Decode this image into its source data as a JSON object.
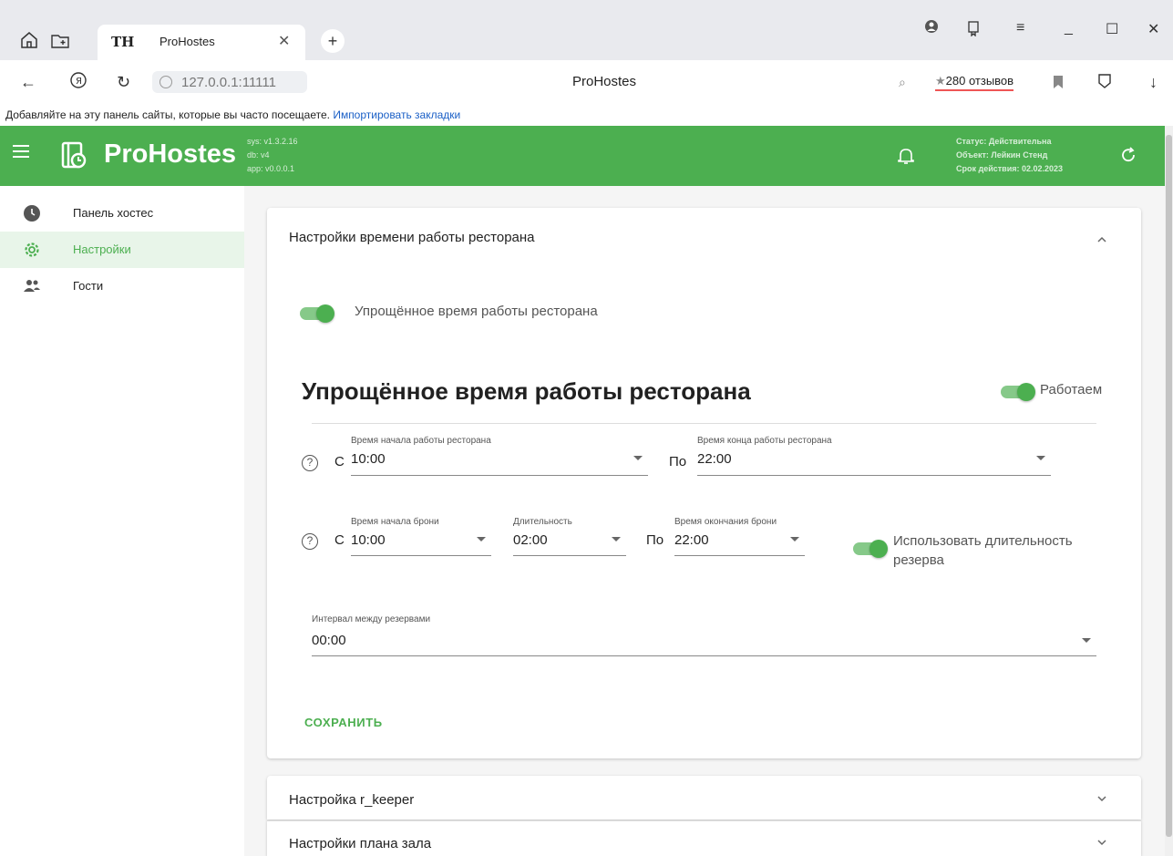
{
  "browser": {
    "tab_title": "ProHostes",
    "tab_favicon": "TН",
    "url": "127.0.0.1:11111",
    "page_title": "ProHostes",
    "reviews": "280 отзывов",
    "bookmarks_text": "Добавляйте на эту панель сайты, которые вы часто посещаете.",
    "bookmarks_link": "Импортировать закладки"
  },
  "header": {
    "brand": "ProHostes",
    "version_sys": "sys: v1.3.2.16",
    "version_db": "db: v4",
    "version_app": "app: v0.0.0.1",
    "status": "Статус: Действительна",
    "object": "Объект: Лейкин Стенд",
    "expiry": "Срок действия: 02.02.2023"
  },
  "sidebar": {
    "items": [
      {
        "label": "Панель хостес",
        "icon": "clock-icon"
      },
      {
        "label": "Настройки",
        "icon": "gear-icon"
      },
      {
        "label": "Гости",
        "icon": "people-icon"
      }
    ]
  },
  "main": {
    "section_title": "Настройки времени работы ресторана",
    "simplified_toggle_label": "Упрощённое время работы ресторана",
    "heading": "Упрощённое время работы ресторана",
    "working_label": "Работаем",
    "hours": {
      "start_label": "Время начала работы ресторана",
      "start_value": "10:00",
      "end_label": "Время конца работы ресторана",
      "end_value": "22:00",
      "from": "С",
      "to": "По"
    },
    "booking": {
      "start_label": "Время начала брони",
      "start_value": "10:00",
      "duration_label": "Длительность",
      "duration_value": "02:00",
      "end_label": "Время окончания брони",
      "end_value": "22:00",
      "from": "С",
      "to": "По",
      "use_duration_label": "Использовать длительность резерва"
    },
    "interval": {
      "label": "Интервал между резервами",
      "value": "00:00"
    },
    "save_label": "СОХРАНИТЬ",
    "qmark": "?"
  },
  "collapsed_sections": [
    {
      "title": "Настройка r_keeper"
    },
    {
      "title": "Настройки плана зала"
    }
  ],
  "colors": {
    "accent": "#4caf50",
    "accent_light": "#e8f5e9"
  }
}
